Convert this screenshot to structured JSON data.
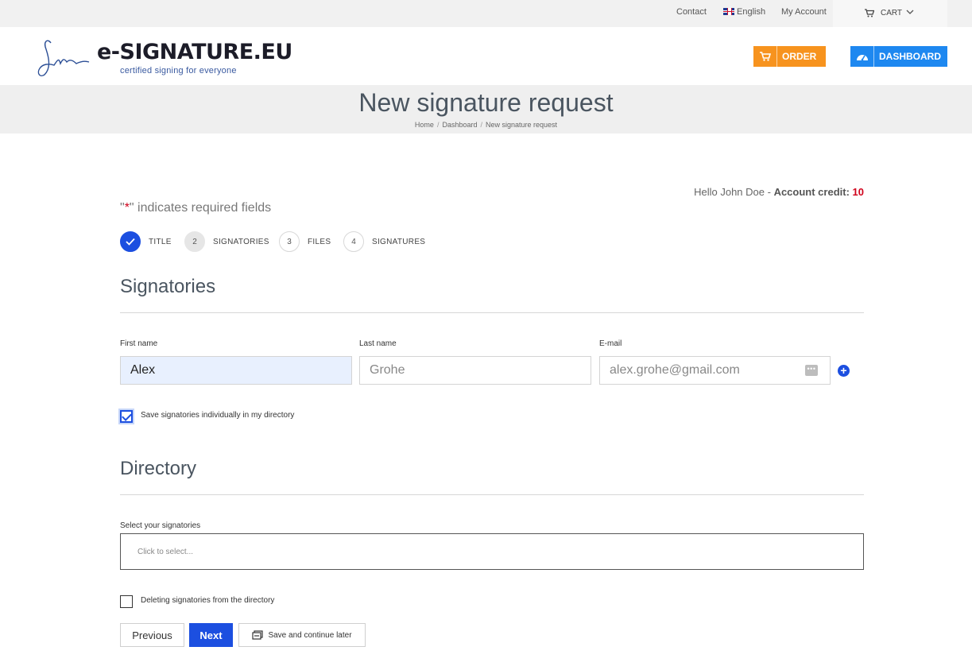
{
  "topbar": {
    "contact": "Contact",
    "language": "English",
    "my_account": "My Account",
    "cart": "CART"
  },
  "brand": {
    "name": "e-SIGNATURE.EU",
    "tagline": "certified signing for everyone"
  },
  "header": {
    "order_label": "ORDER",
    "dashboard_label": "DASHBOARD",
    "order_color": "#f7931e",
    "dashboard_color": "#1e88f0"
  },
  "page": {
    "title": "New signature request",
    "breadcrumb": [
      "Home",
      "Dashboard",
      "New signature request"
    ]
  },
  "account": {
    "greeting": "Hello John Doe - ",
    "credit_label": "Account credit: ",
    "credit_value": "10"
  },
  "form": {
    "required_prefix": "\"",
    "required_star": "*",
    "required_suffix": "\" indicates required fields",
    "steps": [
      {
        "number": "",
        "label": "TITLE",
        "state": "done"
      },
      {
        "number": "2",
        "label": "SIGNATORIES",
        "state": "current"
      },
      {
        "number": "3",
        "label": "FILES",
        "state": "upcoming"
      },
      {
        "number": "4",
        "label": "SIGNATURES",
        "state": "upcoming"
      }
    ],
    "signatories_heading": "Signatories",
    "first_name_label": "First name",
    "first_name_value": "Alex",
    "last_name_label": "Last name",
    "last_name_placeholder": "Grohe",
    "email_label": "E-mail",
    "email_placeholder": "alex.grohe@gmail.com",
    "save_checkbox_label": "Save signatories individually in my directory",
    "save_checkbox_checked": true,
    "directory_heading": "Directory",
    "select_label": "Select your signatories",
    "select_placeholder": "Click to select...",
    "delete_checkbox_label": "Deleting signatories from the directory",
    "delete_checkbox_checked": false,
    "previous_label": "Previous",
    "next_label": "Next",
    "save_later_label": "Save and continue later"
  },
  "colors": {
    "primary": "#1c4fe0",
    "required_red": "#d0021b"
  }
}
